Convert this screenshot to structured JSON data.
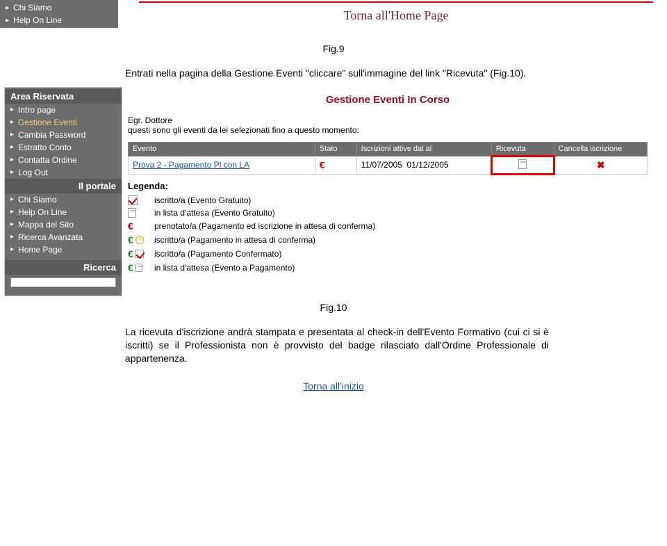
{
  "top_sidebar": {
    "items": [
      "Chi Siamo",
      "Help On Line"
    ]
  },
  "home_link": "Torna all'Home Page",
  "fig9_label": "Fig.9",
  "para1": "Entrati nella pagina della Gestione Eventi \"cliccare\" sull'immagine del link \"Ricevuta\" (Fig.10).",
  "screenshot": {
    "sidebar": {
      "section1_title": "Area Riservata",
      "items1": [
        "Intro page",
        "Gestione Eventi",
        "Cambia Password",
        "Estratto Conto",
        "Contatta Ordine",
        "Log Out"
      ],
      "section2_title": "Il portale",
      "items2": [
        "Chi Siamo",
        "Help On Line",
        "Mappa del Sito",
        "Ricerca Avanzata",
        "Home Page"
      ],
      "section3_title": "Ricerca"
    },
    "content": {
      "title": "Gestione Eventi In Corso",
      "greeting": "Egr. Dottore",
      "intro": "questi sono gli eventi da lei selezionati fino a questo momento:",
      "table": {
        "headers": [
          "Evento",
          "Stato",
          "Iscrizioni attive dal al",
          "Ricevuta",
          "Cancella iscrizione"
        ],
        "rows": [
          {
            "evento": "Prova 2 - Pagamento Pl con LA",
            "date1": "11/07/2005",
            "date2": "01/12/2005"
          }
        ]
      },
      "legend_title": "Legenda:",
      "legend": [
        "iscritto/a (Evento Gratuito)",
        "in lista d'attesa (Evento Gratuito)",
        "prenotato/a (Pagamento ed iscrizione in attesa di conferma)",
        "iscritto/a (Pagamento in attesa di conferma)",
        "iscritto/a (Pagamento Confermato)",
        "in lista d'attesa (Evento a Pagamento)"
      ]
    }
  },
  "fig10_label": "Fig.10",
  "para2": "La ricevuta d'iscrizione andrà stampata e presentata al check-in dell'Evento Formativo (cui ci si è iscritti) se il Professionista non è provvisto del badge rilasciato dall'Ordine Professionale di appartenenza.",
  "back_link": "Torna all'inizio"
}
